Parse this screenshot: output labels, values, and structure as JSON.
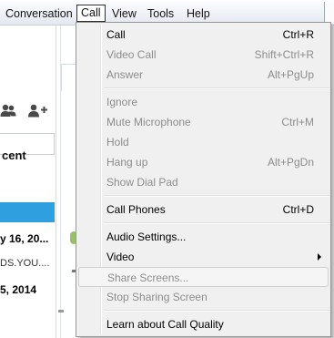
{
  "menubar": {
    "items": [
      {
        "label": "Conversation"
      },
      {
        "label": "Call"
      },
      {
        "label": "View"
      },
      {
        "label": "Tools"
      },
      {
        "label": "Help"
      }
    ]
  },
  "background": {
    "recent_label": "cent",
    "date1": "y 16, 20...",
    "preview1": "DS.YOU....",
    "date2": "5, 2014",
    "bottom_link": "~~~~~~~~~~",
    "bottom_link2": "~~~~~~~~~~"
  },
  "call_menu": {
    "groups": [
      [
        {
          "label": "Call",
          "shortcut": "Ctrl+R",
          "enabled": true
        },
        {
          "label": "Video Call",
          "shortcut": "Shift+Ctrl+R",
          "enabled": false
        },
        {
          "label": "Answer",
          "shortcut": "Alt+PgUp",
          "enabled": false
        }
      ],
      [
        {
          "label": "Ignore",
          "shortcut": "",
          "enabled": false
        },
        {
          "label": "Mute Microphone",
          "shortcut": "Ctrl+M",
          "enabled": false
        },
        {
          "label": "Hold",
          "shortcut": "",
          "enabled": false
        },
        {
          "label": "Hang up",
          "shortcut": "Alt+PgDn",
          "enabled": false
        },
        {
          "label": "Show Dial Pad",
          "shortcut": "",
          "enabled": false
        }
      ],
      [
        {
          "label": "Call Phones",
          "shortcut": "Ctrl+D",
          "enabled": true
        }
      ],
      [
        {
          "label": "Audio Settings...",
          "shortcut": "",
          "enabled": true
        },
        {
          "label": "Video",
          "shortcut": "",
          "enabled": true,
          "submenu": true
        },
        {
          "label": "Share Screens...",
          "shortcut": "",
          "enabled": false,
          "highlighted": true
        },
        {
          "label": "Stop Sharing Screen",
          "shortcut": "",
          "enabled": false
        }
      ],
      [
        {
          "label": "Learn about Call Quality",
          "shortcut": "",
          "enabled": true
        }
      ]
    ]
  },
  "colors": {
    "accent": "#2f9fe0",
    "disabled_text": "#8d8d8d",
    "menu_bg": "#f0f0f0"
  },
  "icons": [
    "contacts-icon",
    "add-contact-icon",
    "submenu-arrow-icon"
  ]
}
